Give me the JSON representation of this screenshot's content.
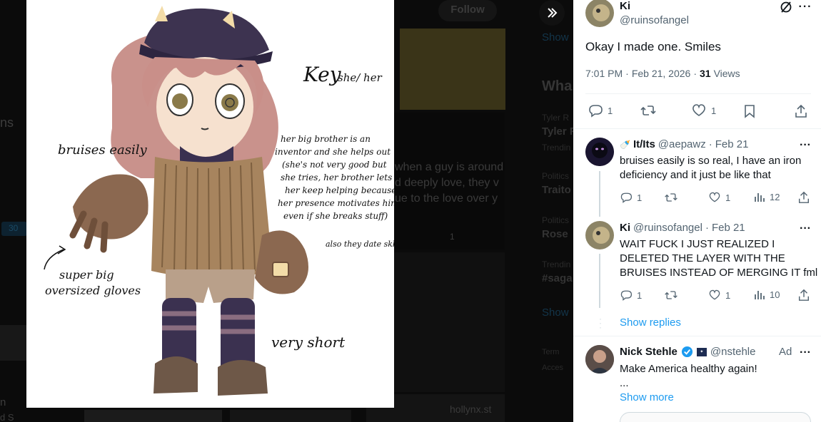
{
  "background": {
    "follow_label": "Follow",
    "left_fragments": [
      "ns",
      "n",
      "d S"
    ],
    "badge": "30",
    "show_more": "Show",
    "whats_happening": "Wha",
    "post_text_lines": [
      "when a guy is around",
      "d deeply love, they v",
      "ue to the love over y"
    ],
    "post_user": "",
    "like_count": "1",
    "bottom_user": "hollynx.st",
    "trends": [
      {
        "context": "Tyler R",
        "name": "Tyler F"
      },
      {
        "context": "Trendin",
        "name": ""
      },
      {
        "context": "Politics",
        "name": "Traito"
      },
      {
        "context": "Politics",
        "name": "Rose"
      },
      {
        "context": "Trendin",
        "name": "#saga"
      }
    ],
    "show_more_2": "Show",
    "footer_1": "Term",
    "footer_2": "Acces"
  },
  "media": {
    "annotations": {
      "key": "Key",
      "pronouns": "she/ her",
      "bruises": "bruises easily",
      "brother_lines": [
        "her big brother is an",
        "inventor and she helps out",
        "(she's not very good but",
        "she tries, her brother lets",
        "her keep helping because",
        "her presence motivates him",
        "even if she breaks stuff)"
      ],
      "date": "also they date skk",
      "gloves_lines": [
        "super big",
        "oversized gloves"
      ],
      "short": "very short"
    }
  },
  "tweet": {
    "name": "Ki",
    "handle": "@ruinsofangel",
    "text": "Okay I made one. Smiles",
    "time": "7:01 PM",
    "date": "Feb 21, 2026",
    "views_count": "31",
    "views_label": "Views",
    "replies": "1",
    "reposts": "",
    "likes": "1"
  },
  "replies": [
    {
      "name": "It/Its",
      "handle": "@aepawz",
      "date": "Feb 21",
      "lines": [
        "bruises easily is so real, I have an iron",
        "deficiency and it just be like that"
      ],
      "replies": "1",
      "likes": "1",
      "views": "12"
    },
    {
      "name": "Ki",
      "handle": "@ruinsofangel",
      "date": "Feb 21",
      "lines": [
        "WAIT FUCK I JUST REALIZED I",
        "DELETED THE LAYER WITH THE",
        "BRUISES INSTEAD OF MERGING IT fml"
      ],
      "replies": "1",
      "likes": "1",
      "views": "10"
    }
  ],
  "show_replies": "Show replies",
  "ad": {
    "name": "Nick Stehle",
    "handle": "@nstehle",
    "ad_label": "Ad",
    "text": "Make America healthy again!",
    "ellipsis": "...",
    "show_more": "Show more"
  },
  "colors": {
    "accent": "#1d9bf0",
    "text": "#0f1419",
    "muted": "#536471"
  }
}
